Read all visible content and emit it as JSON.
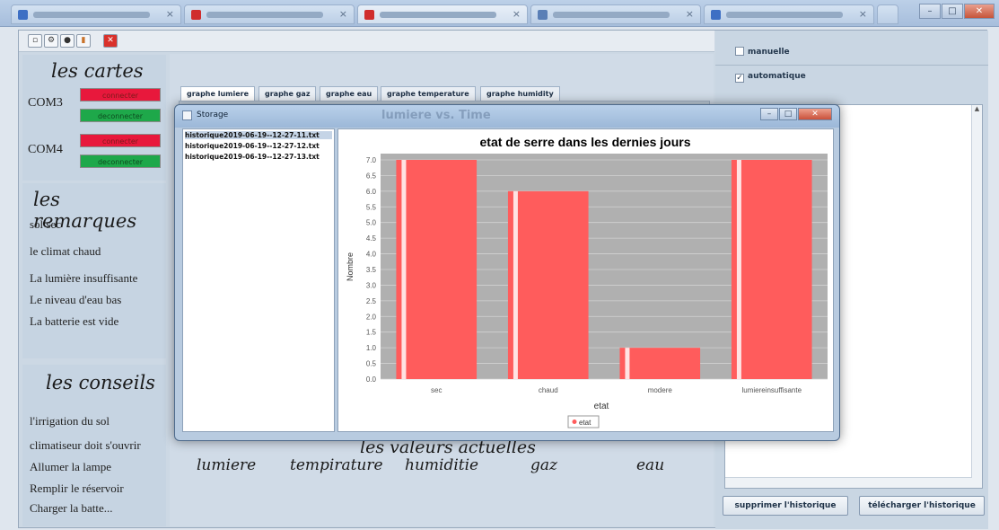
{
  "left": {
    "cartes_title": "les cartes",
    "com3_label": "COM3",
    "com4_label": "COM4",
    "connect_label": "connecter",
    "disconnect_label": "deconnecter",
    "remarques_title": "les remarques",
    "remarques": [
      "sol sec",
      "le climat chaud",
      "La lumière insuffisante",
      "Le niveau d'eau bas",
      "La batterie est vide"
    ],
    "conseils_title": "les conseils",
    "conseils": [
      "l'irrigation du sol",
      "climatiseur doit s'ouvrir",
      "Allumer la lampe",
      "Remplir le réservoir",
      "Charger la batte..."
    ]
  },
  "center": {
    "tabs": [
      "graphe lumiere",
      "graphe gaz",
      "graphe eau",
      "graphe temperature",
      "graphe humidity"
    ],
    "background_title": "lumiere vs. Time",
    "values_title": "les valeurs actuelles",
    "values_labels": [
      "lumiere",
      "tempirature",
      "humiditie",
      "gaz",
      "eau"
    ]
  },
  "right": {
    "mode_manual": "manuelle",
    "mode_auto": "automatique",
    "delete_history": "supprimer l'historique",
    "download_history": "télécharger l'historique"
  },
  "dialog": {
    "title": "Storage",
    "files": [
      "historique2019-06-19--12-27-11.txt",
      "historique2019-06-19--12-27-12.txt",
      "historique2019-06-19--12-27-13.txt"
    ]
  },
  "colors": {
    "bar_fill": "#ff5c5c",
    "bar_highlight": "#ffe3e3",
    "plot_bg": "#b0b0b0",
    "connect": "#e8183c",
    "disconnect": "#1ea84a"
  },
  "chart_data": {
    "type": "bar",
    "title": "etat de serre dans les dernies jours",
    "xlabel": "etat",
    "ylabel": "Nombre",
    "categories": [
      "sec",
      "chaud",
      "modere",
      "lumiereinsuffisante"
    ],
    "series": [
      {
        "name": "etat",
        "values": [
          7.0,
          6.0,
          1.0,
          7.0
        ]
      }
    ],
    "ylim": [
      0,
      7.2
    ],
    "yticks": [
      "0.0",
      "0.5",
      "1.0",
      "1.5",
      "2.0",
      "2.5",
      "3.0",
      "3.5",
      "4.0",
      "4.5",
      "5.0",
      "5.5",
      "6.0",
      "6.5",
      "7.0"
    ],
    "grid": true,
    "legend": "bottom"
  }
}
